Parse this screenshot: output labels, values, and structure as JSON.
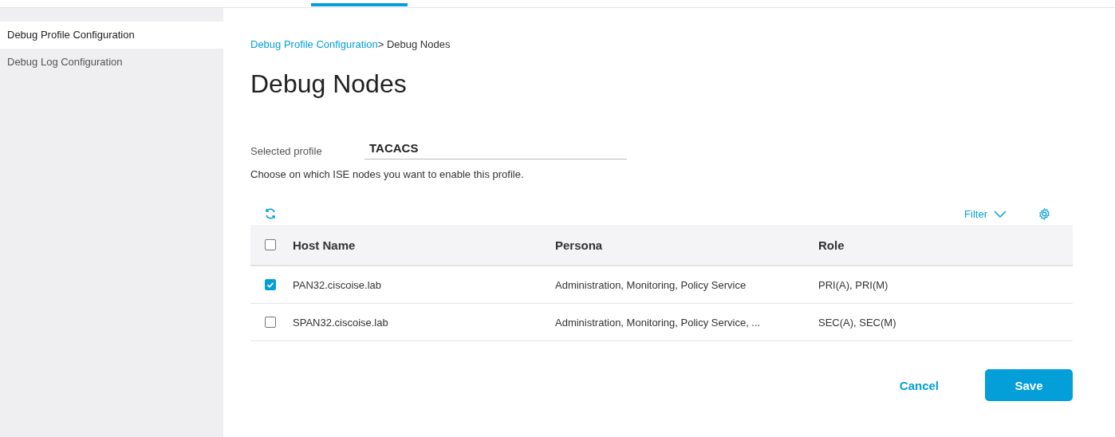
{
  "sidebar": {
    "items": [
      {
        "label": "Debug Profile Configuration",
        "selected": true
      },
      {
        "label": "Debug Log Configuration",
        "selected": false
      }
    ]
  },
  "breadcrumb": {
    "link": "Debug Profile Configuration",
    "current": "> Debug Nodes"
  },
  "title": "Debug Nodes",
  "profile": {
    "label": "Selected profile",
    "value": "TACACS"
  },
  "help": "Choose on which ISE nodes you want to enable this profile.",
  "toolbar": {
    "filter": "Filter"
  },
  "table": {
    "columns": [
      "Host Name",
      "Persona",
      "Role"
    ],
    "all_checked": false,
    "rows": [
      {
        "host": "PAN32.ciscoise.lab",
        "persona": "Administration, Monitoring, Policy Service",
        "role": "PRI(A), PRI(M)",
        "checked": true
      },
      {
        "host": "SPAN32.ciscoise.lab",
        "persona": "Administration, Monitoring, Policy Service, ...",
        "role": "SEC(A), SEC(M)",
        "checked": false
      }
    ]
  },
  "buttons": {
    "cancel": "Cancel",
    "save": "Save"
  }
}
